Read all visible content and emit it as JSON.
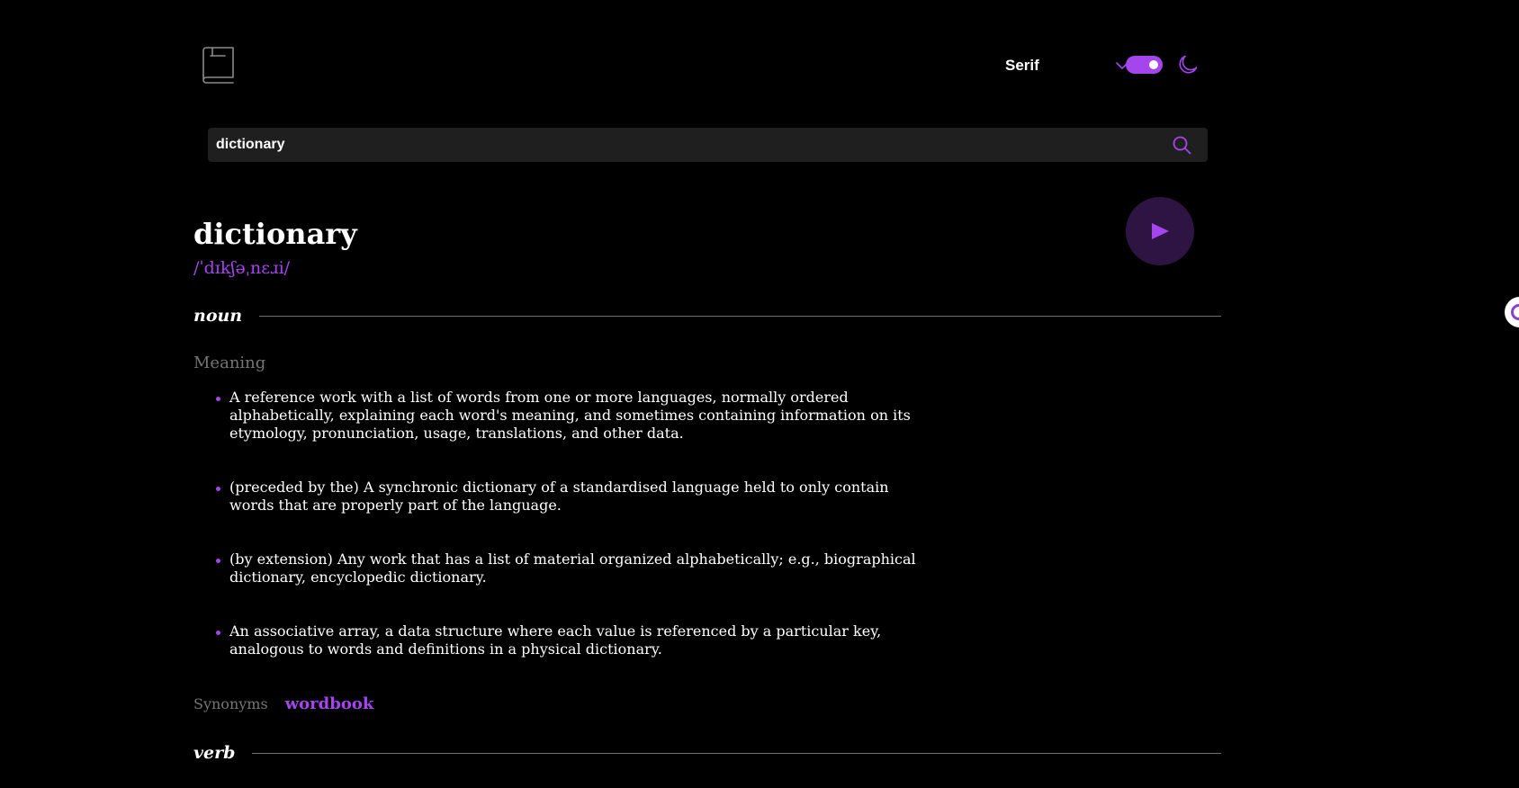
{
  "colors": {
    "background": "#000000",
    "accent": "#a445ed",
    "search_bg": "#1f1f1f",
    "muted": "#757575",
    "divider": "#6e6e6e",
    "play_bg": "#2e1443"
  },
  "header": {
    "logo_icon": "book-icon",
    "font_selector": {
      "selected": "Serif",
      "icon": "chevron-down-icon"
    },
    "theme_toggle": {
      "state": "dark",
      "icon": "moon-icon"
    }
  },
  "search": {
    "value": "dictionary",
    "icon": "search-icon"
  },
  "entry": {
    "word": "dictionary",
    "phonetic": "/ˈdɪkʃəˌnɛɹi/",
    "play_icon": "play-icon"
  },
  "noun": {
    "part_of_speech": "noun",
    "meaning_label": "Meaning",
    "definitions": [
      "A reference work with a list of words from one or more languages, normally ordered alphabetically, explaining each word's meaning, and sometimes containing information on its etymology, pronunciation, usage, translations, and other data.",
      "(preceded by the) A synchronic dictionary of a standardised language held to only contain words that are properly part of the language.",
      "(by extension) Any work that has a list of material organized alphabetically; e.g., biographical dictionary, encyclopedic dictionary.",
      "An associative array, a data structure where each value is referenced by a particular key, analogous to words and definitions in a physical dictionary."
    ],
    "synonyms_label": "Synonyms",
    "synonyms": [
      "wordbook"
    ]
  },
  "verb": {
    "part_of_speech": "verb"
  }
}
